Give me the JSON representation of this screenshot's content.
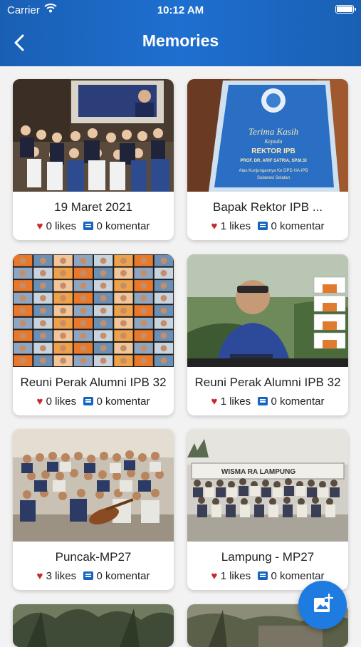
{
  "status_bar": {
    "carrier": "Carrier",
    "time": "10:12 AM"
  },
  "header": {
    "title": "Memories"
  },
  "memories": [
    {
      "caption": "19 Maret 2021",
      "likes": "0 likes",
      "comments": "0 komentar"
    },
    {
      "caption": "Bapak Rektor IPB ...",
      "likes": "1 likes",
      "comments": "0 komentar"
    },
    {
      "caption": "Reuni Perak Alumni IPB 32",
      "likes": "0 likes",
      "comments": "0 komentar"
    },
    {
      "caption": "Reuni Perak Alumni IPB 32",
      "likes": "1 likes",
      "comments": "0 komentar"
    },
    {
      "caption": "Puncak-MP27",
      "likes": "3 likes",
      "comments": "0 komentar"
    },
    {
      "caption": "Lampung - MP27",
      "likes": "1 likes",
      "comments": "0 komentar"
    }
  ],
  "plaque": {
    "line1": "Terima Kasih",
    "line2": "Kepada",
    "line3": "REKTOR IPB",
    "line4": "PROF. DR. ARIF SATRIA, SP.M.SI",
    "line5": "Atas Kunjungannya Ke DPD HA-IPB",
    "line6": "Sulawesi Selatan"
  },
  "photo_sign": {
    "text": "WISMA RA LAMPUNG"
  },
  "colors": {
    "appbar": "#1a5fb4",
    "heart": "#c62828",
    "comment": "#1565c0",
    "fab": "#1e7be0"
  },
  "icons": {
    "back": "chevron-left-icon",
    "like": "heart-icon",
    "comment": "comment-icon",
    "fab": "add-photo-icon"
  }
}
